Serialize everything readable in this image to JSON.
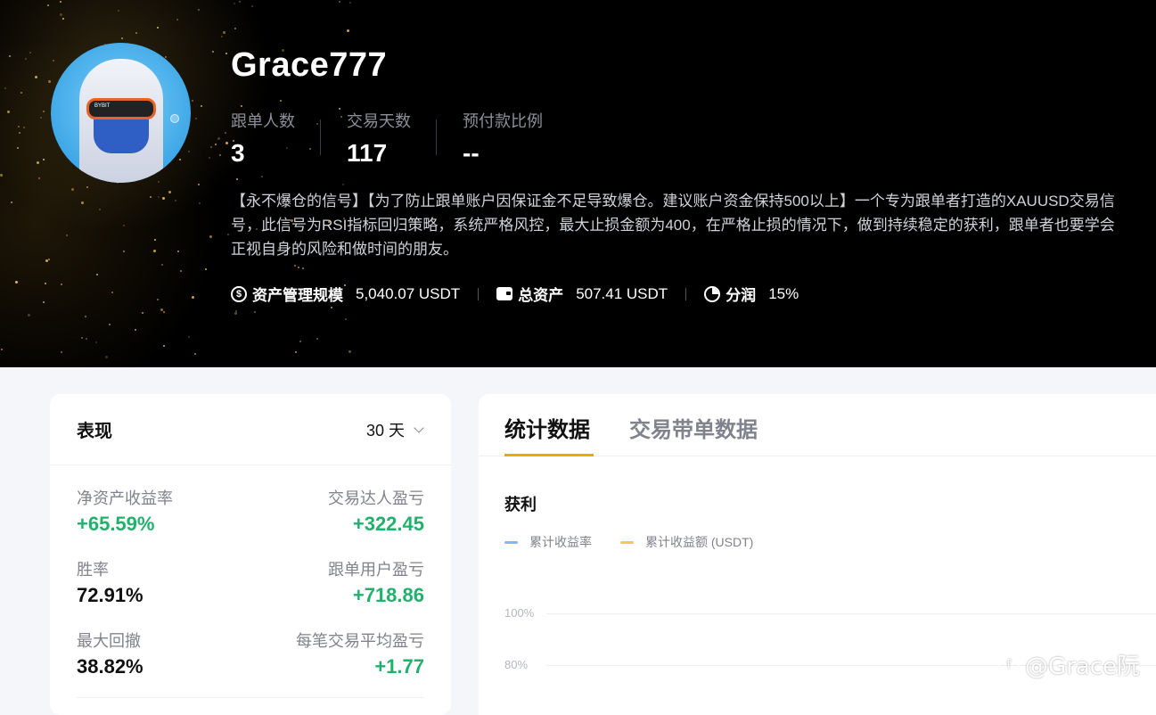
{
  "profile": {
    "name": "Grace777",
    "avatar_text": "BYBIT",
    "stats": [
      {
        "label": "跟单人数",
        "value": "3"
      },
      {
        "label": "交易天数",
        "value": "117"
      },
      {
        "label": "预付款比例",
        "value": "--"
      }
    ],
    "description": "【永不爆仓的信号】【为了防止跟单账户因保证金不足导致爆仓。建议账户资金保持500以上】一个专为跟单者打造的XAUUSD交易信号，此信号为RSI指标回归策略，系统严格风控，最大止损金额为400，在严格止损的情况下，做到持续稳定的获利，跟单者也要学会正视自身的风险和做时间的朋友。",
    "aum": {
      "label": "资产管理规模",
      "value": "5,040.07 USDT",
      "icon": "dollar-circle-icon"
    },
    "total_assets": {
      "label": "总资产",
      "value": "507.41 USDT",
      "icon": "wallet-icon"
    },
    "profit_share": {
      "label": "分润",
      "value": "15%",
      "icon": "pie-chart-icon"
    }
  },
  "performance": {
    "title": "表现",
    "period": "30 天",
    "metrics": [
      {
        "label": "净资产收益率",
        "value": "+65.59%"
      },
      {
        "label": "交易达人盈亏",
        "value": "+322.45"
      },
      {
        "label": "胜率",
        "value": "72.91%"
      },
      {
        "label": "跟单用户盈亏",
        "value": "+718.86"
      },
      {
        "label": "最大回撤",
        "value": "38.82%"
      },
      {
        "label": "每笔交易平均盈亏",
        "value": "+1.77"
      }
    ]
  },
  "stats_panel": {
    "tabs": [
      "统计数据",
      "交易带单数据"
    ],
    "section_title": "获利",
    "legend": [
      {
        "label": "累计收益率",
        "color": "#8ab4f8"
      },
      {
        "label": "累计收益额 (USDT)",
        "color": "#f7c94a"
      }
    ],
    "grid_labels": [
      "100%",
      "80%"
    ]
  },
  "watermark": "@Grace阮",
  "colors": {
    "accent": "#f7a600",
    "positive": "#20b26c"
  }
}
